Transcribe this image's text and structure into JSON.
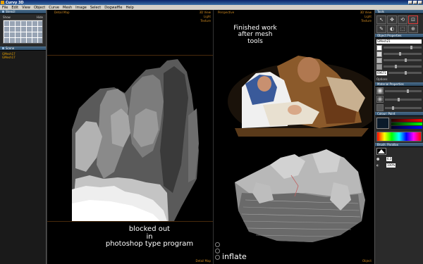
{
  "window": {
    "title": "Curvy 3D"
  },
  "menu": [
    "File",
    "Edit",
    "View",
    "Object",
    "Curve",
    "Mesh",
    "Image",
    "Select",
    "Dogwaffle",
    "Help"
  ],
  "left_panel": {
    "stencil_title": "Stencil",
    "stencil_show": "Show",
    "stencil_hide": "Hide",
    "scene_title": "Scene",
    "scene_items": [
      "GMesh17",
      "GMesh17"
    ]
  },
  "left_view": {
    "top_label": "Detail Map",
    "corner_labels": [
      "3D View",
      "Light",
      "Texture"
    ],
    "bottom_label": "Detail Map"
  },
  "right_view": {
    "top_label": "Perspective",
    "corner_labels": [
      "3D View",
      "Light",
      "Texture"
    ],
    "bottom_label": "Object"
  },
  "captions": {
    "finished": [
      "Finished work",
      "after mesh",
      "tools"
    ],
    "blocked": [
      "blocked out",
      "in",
      "photoshop type program"
    ],
    "inflate": "inflate"
  },
  "right_panel": {
    "tools_title": "Tools",
    "tools": [
      "↖",
      "✥",
      "⟲",
      "⊡",
      "✎",
      "◐",
      "⬚",
      "⊕"
    ],
    "object_title": "Object Properties",
    "object_name": "GMesh21",
    "value_field": "69671",
    "options_label": "Options",
    "material_title": "Material Properties",
    "colour_title": "Colour: Paint",
    "brush_title": "Brush: Parallax",
    "brush_size": "6.3",
    "brush_opacity": "100%"
  },
  "colors": {
    "titlebar": "#0a246a",
    "label_orange": "#d08a20",
    "scene_orange": "#e8a200"
  }
}
